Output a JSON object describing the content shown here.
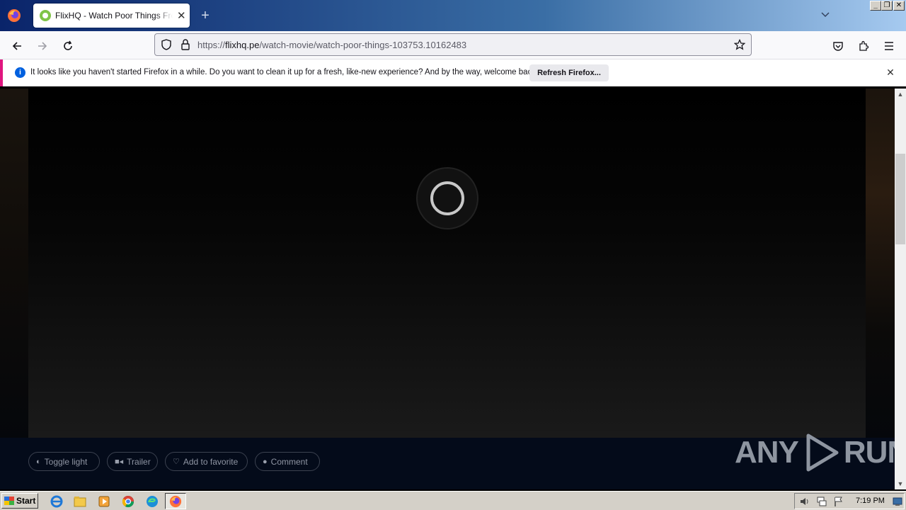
{
  "browser": {
    "tab_title": "FlixHQ - Watch Poor Things Free S",
    "tab_close": "✕",
    "new_tab": "+",
    "url_prefix": "https://",
    "url_host": "flixhq.pe",
    "url_path": "/watch-movie/watch-poor-things-103753.10162483"
  },
  "notification": {
    "icon": "i",
    "text": "It looks like you haven't started Firefox in a while. Do you want to clean it up for a fresh, like-new experience? And by the way, welcome back!",
    "button": "Refresh Firefox...",
    "close": "✕"
  },
  "actions": {
    "toggle_light": "Toggle light",
    "trailer": "Trailer",
    "add_favorite": "Add to favorite",
    "comment": "Comment"
  },
  "watermark": {
    "left": "ANY",
    "right": "RUN"
  },
  "taskbar": {
    "start": "Start",
    "clock": "7:19 PM"
  },
  "colors": {
    "accent_notification": "#e0167f",
    "info_blue": "#0060df",
    "player_bg": "#000000",
    "bottom_bar": "#040b1a"
  }
}
